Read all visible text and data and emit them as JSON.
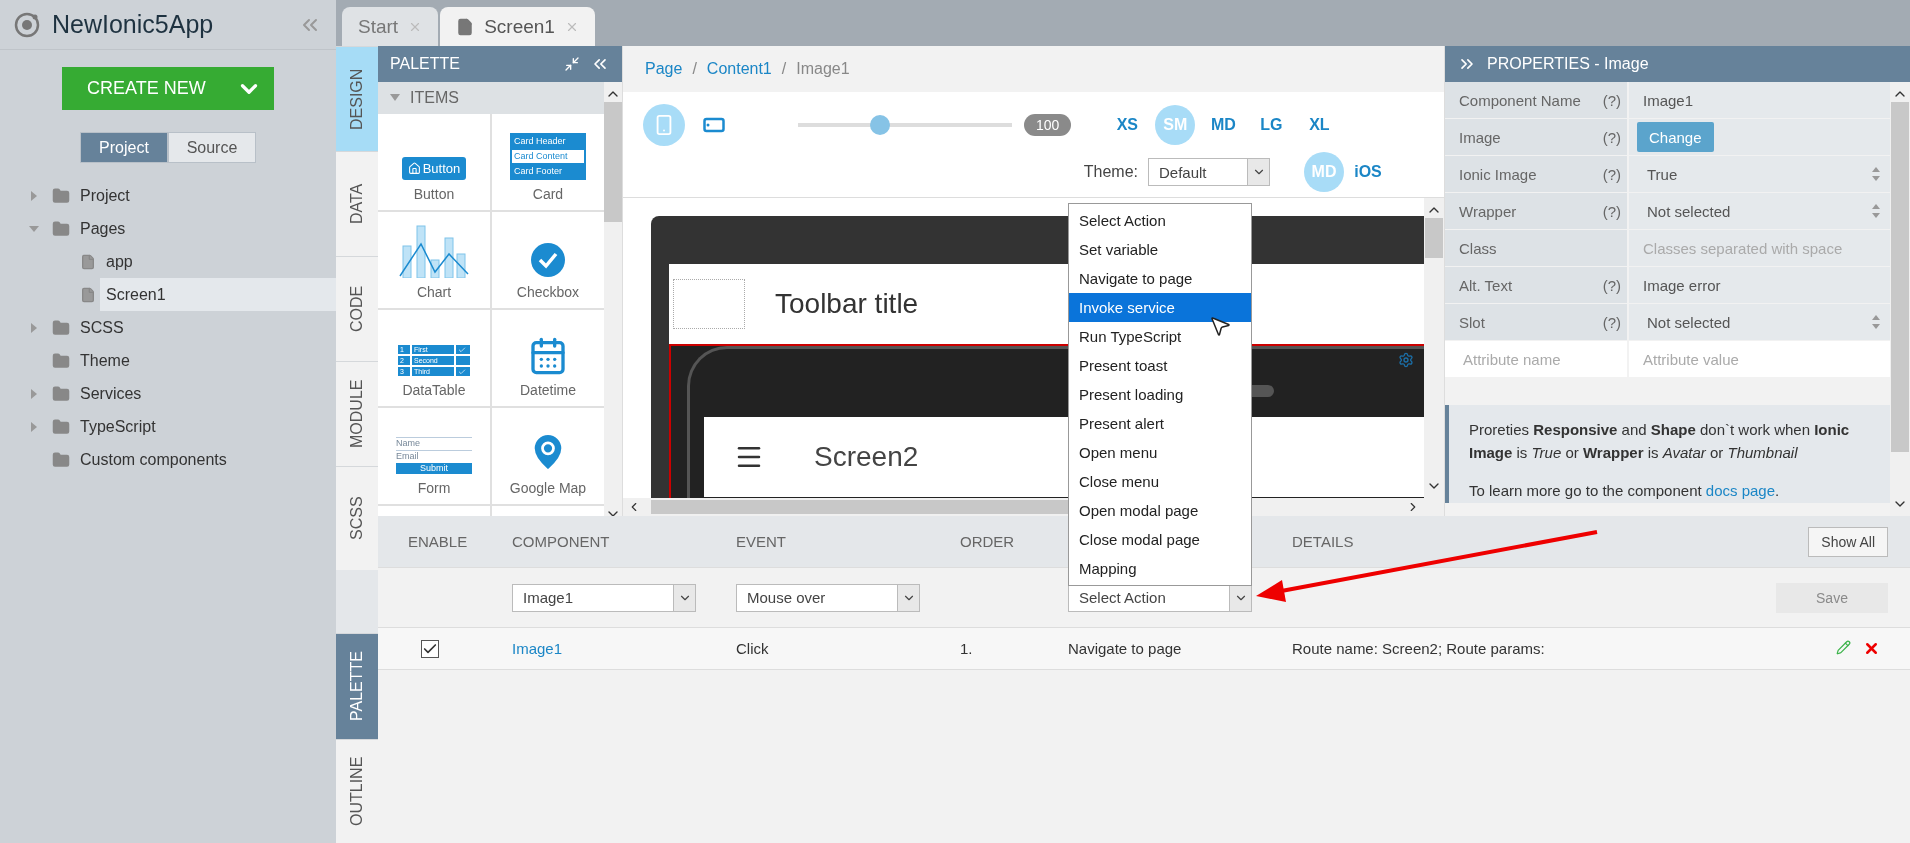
{
  "app": {
    "title": "NewIonic5App"
  },
  "create_button": "CREATE NEW",
  "view_tabs": [
    {
      "label": "Project",
      "selected": true
    },
    {
      "label": "Source",
      "selected": false
    }
  ],
  "tree": [
    {
      "label": "Project",
      "kind": "folder",
      "expanded": false
    },
    {
      "label": "Pages",
      "kind": "folder",
      "expanded": true,
      "children": [
        {
          "label": "app",
          "kind": "page",
          "selected": false
        },
        {
          "label": "Screen1",
          "kind": "page",
          "selected": true
        }
      ]
    },
    {
      "label": "SCSS",
      "kind": "folder",
      "expanded": false
    },
    {
      "label": "Theme",
      "kind": "folder"
    },
    {
      "label": "Services",
      "kind": "folder",
      "expanded": false
    },
    {
      "label": "TypeScript",
      "kind": "folder",
      "expanded": false
    },
    {
      "label": "Custom components",
      "kind": "folder"
    }
  ],
  "editor_tabs": [
    {
      "label": "Start",
      "kind": "plain",
      "selected": false
    },
    {
      "label": "Screen1",
      "kind": "page",
      "selected": true
    }
  ],
  "side_tabs_top": [
    {
      "label": "DESIGN",
      "selected": true
    },
    {
      "label": "DATA",
      "selected": false
    },
    {
      "label": "CODE",
      "selected": false
    },
    {
      "label": "MODULE",
      "selected": false
    },
    {
      "label": "SCSS",
      "selected": false
    }
  ],
  "side_tabs_bottom": [
    {
      "label": "PALETTE",
      "selected": true
    },
    {
      "label": "OUTLINE",
      "selected": false
    }
  ],
  "palette": {
    "title": "PALETTE",
    "section": "ITEMS",
    "expanded": true,
    "items": [
      {
        "label": "Button",
        "kind": "button",
        "preview": [
          "Button"
        ]
      },
      {
        "label": "Card",
        "kind": "card",
        "preview": [
          "Card Header",
          "Card Content",
          "Card Footer"
        ]
      },
      {
        "label": "Chart",
        "kind": "chart"
      },
      {
        "label": "Checkbox",
        "kind": "checkbox"
      },
      {
        "label": "DataTable",
        "kind": "datatable",
        "rows": [
          {
            "number": "1",
            "label": "First",
            "checked": true
          },
          {
            "number": "2",
            "label": "Second",
            "checked": false
          },
          {
            "number": "3",
            "label": "Third",
            "checked": true
          }
        ]
      },
      {
        "label": "Datetime",
        "kind": "datetime"
      },
      {
        "label": "Form",
        "kind": "form",
        "preview": [
          "Name",
          "Email",
          "Submit"
        ]
      },
      {
        "label": "Google Map",
        "kind": "map"
      }
    ]
  },
  "breadcrumb": [
    {
      "label": "Page",
      "link": true
    },
    {
      "separator": "/",
      "label": "Content1",
      "link": true
    },
    {
      "separator": "/",
      "label": "Image1",
      "link": false
    }
  ],
  "toolbar": {
    "devices": [
      {
        "kind": "phone",
        "selected": true
      },
      {
        "kind": "tablet",
        "selected": false
      }
    ],
    "zoom": {
      "level": 0.37,
      "reading": "100"
    },
    "sizes": [
      {
        "label": "XS",
        "selected": false
      },
      {
        "label": "SM",
        "selected": true
      },
      {
        "label": "MD",
        "selected": false
      },
      {
        "label": "LG",
        "selected": false
      },
      {
        "label": "XL",
        "selected": false
      }
    ],
    "theme_label": "Theme:",
    "theme_value": "Default",
    "modes": [
      {
        "label": "MD",
        "selected": true
      },
      {
        "label": "iOS",
        "selected": false
      }
    ]
  },
  "preview": {
    "toolbar_title": "Toolbar title",
    "screen_title": "Screen2"
  },
  "action_menu": {
    "items": [
      {
        "label": "Select Action",
        "selected": false
      },
      {
        "label": "Set variable",
        "selected": false
      },
      {
        "label": "Navigate to page",
        "selected": false
      },
      {
        "label": "Invoke service",
        "selected": true
      },
      {
        "label": "Run TypeScript",
        "selected": false
      },
      {
        "label": "Present toast",
        "selected": false
      },
      {
        "label": "Present loading",
        "selected": false
      },
      {
        "label": "Present alert",
        "selected": false
      },
      {
        "label": "Open menu",
        "selected": false
      },
      {
        "label": "Close menu",
        "selected": false
      },
      {
        "label": "Open modal page",
        "selected": false
      },
      {
        "label": "Close modal page",
        "selected": false
      },
      {
        "label": "Mapping",
        "selected": false
      }
    ]
  },
  "properties": {
    "title": "PROPERTIES - Image",
    "rows": [
      {
        "label": "Component Name",
        "help": "(?)",
        "kind": "text",
        "value": "Image1"
      },
      {
        "label": "Image",
        "help": "(?)",
        "kind": "button",
        "value": "Change"
      },
      {
        "label": "Ionic Image",
        "help": "(?)",
        "kind": "select",
        "value": "True"
      },
      {
        "label": "Wrapper",
        "help": "(?)",
        "kind": "select",
        "value": "Not selected"
      },
      {
        "label": "Class",
        "kind": "input",
        "placeholder": "Classes separated with space"
      },
      {
        "label": "Alt. Text",
        "help": "(?)",
        "kind": "text",
        "value": "Image error"
      },
      {
        "label": "Slot",
        "help": "(?)",
        "kind": "select",
        "value": "Not selected"
      }
    ],
    "attribute": {
      "name_placeholder": "Attribute name",
      "value_placeholder": "Attribute value"
    },
    "note": "Proreties **Responsive** and **Shape** don`t work when **Ionic Image** is *True* or **Wrapper** is *Avatar* or *Thumbnail*",
    "docs": {
      "text": "To learn more go to the component",
      "link": "docs page",
      "end": "."
    }
  },
  "events": {
    "columns": [
      "ENABLE",
      "COMPONENT",
      "EVENT",
      "ORDER",
      "DETAILS"
    ],
    "show_all": "Show All",
    "new_row": {
      "component": "Image1",
      "event": "Mouse over",
      "action": "Select Action",
      "save": "Save",
      "save_disabled": true
    },
    "rows": [
      {
        "enabled": true,
        "component": "Image1",
        "event": "Click",
        "order": "1.",
        "action": "Navigate to page",
        "details": "Route name: Screen2; Route params:"
      }
    ]
  }
}
